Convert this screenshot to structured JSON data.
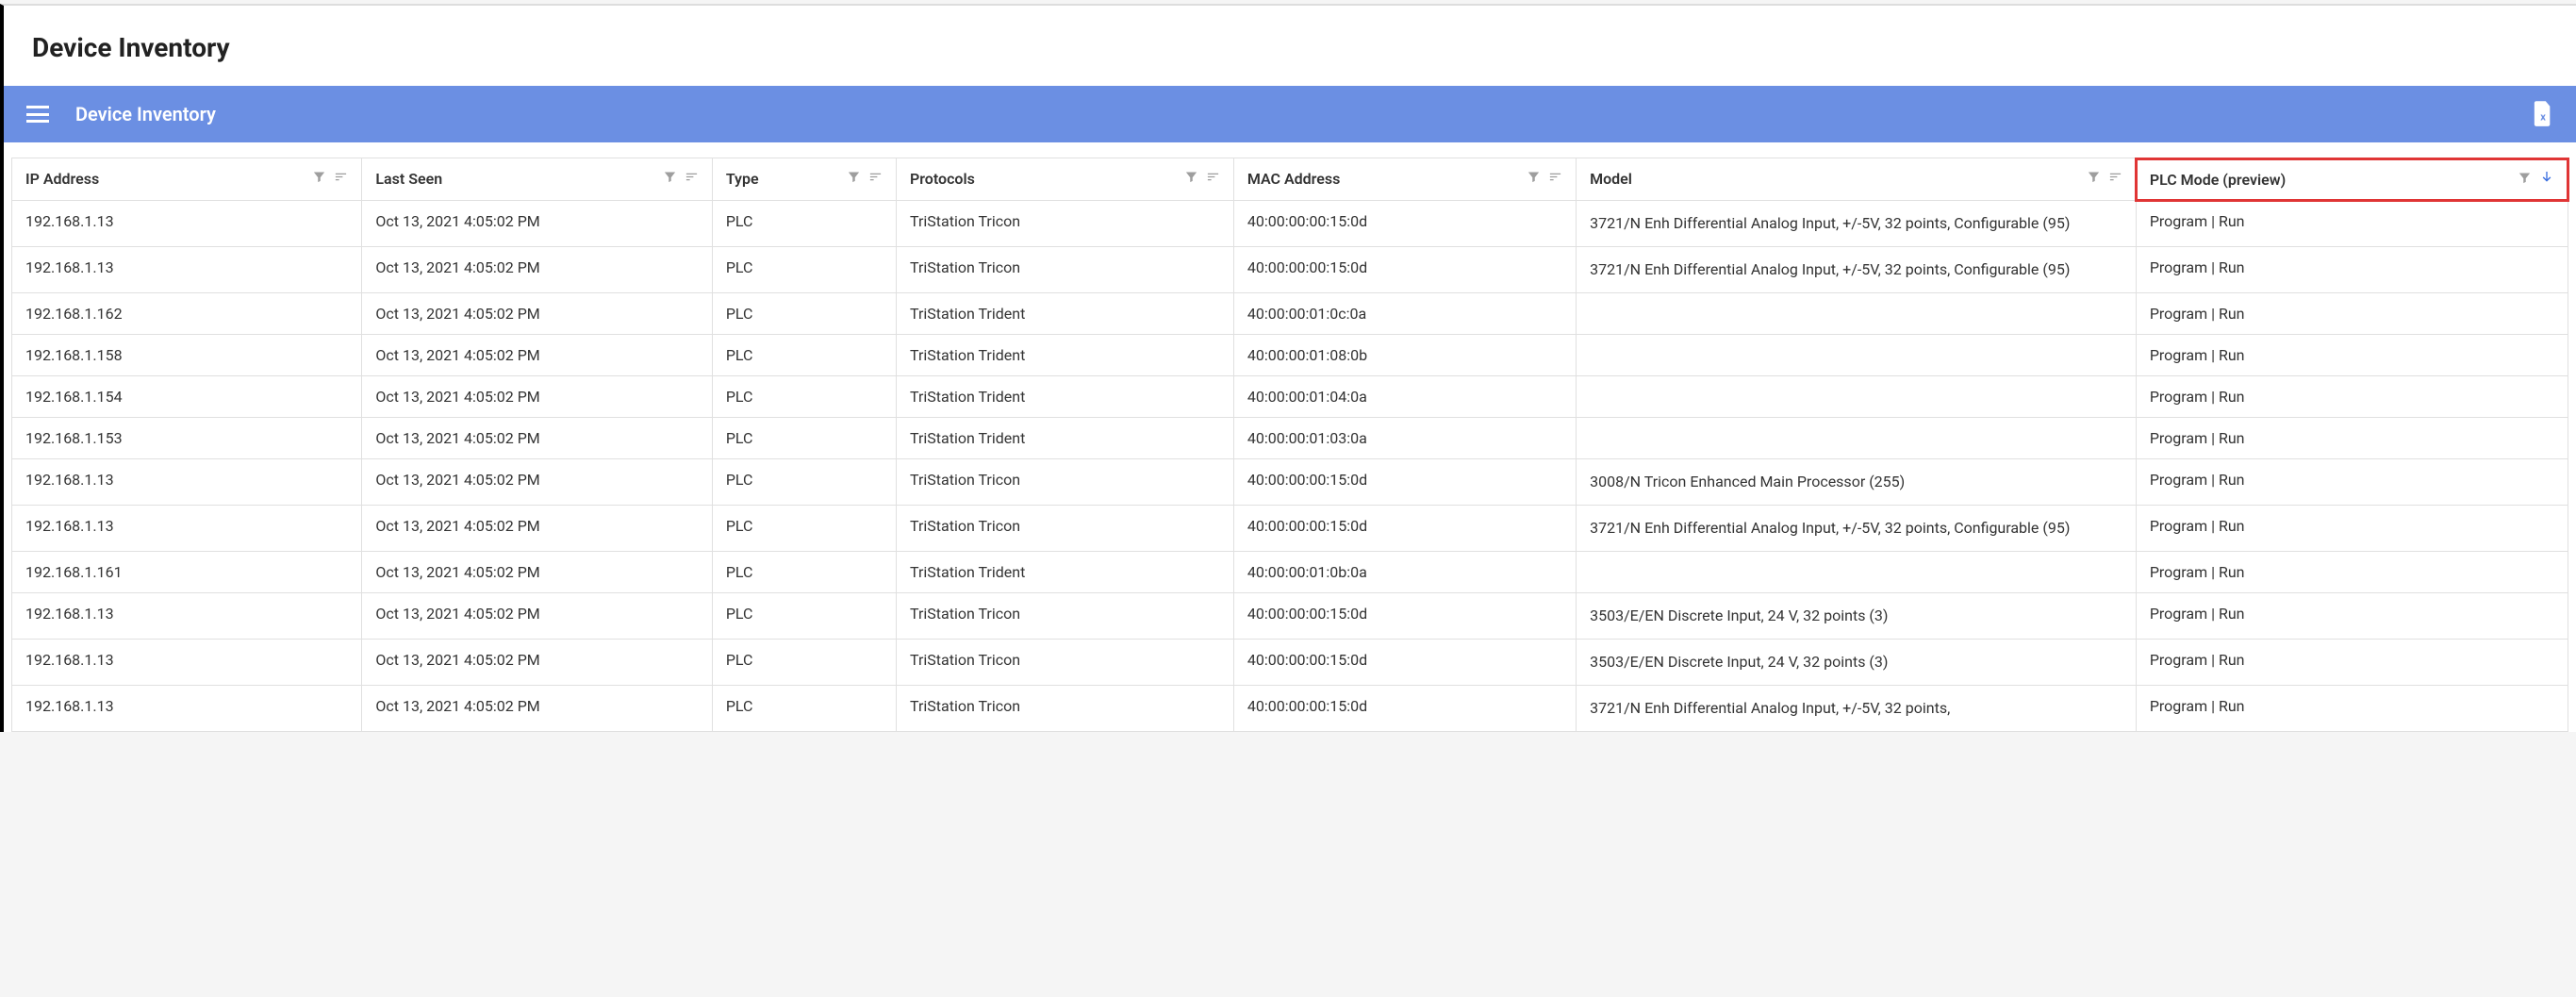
{
  "page": {
    "title": "Device Inventory"
  },
  "header": {
    "title": "Device Inventory"
  },
  "columns": {
    "ip": {
      "label": "IP Address"
    },
    "lastSeen": {
      "label": "Last Seen"
    },
    "type": {
      "label": "Type"
    },
    "proto": {
      "label": "Protocols"
    },
    "mac": {
      "label": "MAC Address"
    },
    "model": {
      "label": "Model"
    },
    "plc": {
      "label": "PLC Mode (preview)"
    }
  },
  "rows": [
    {
      "ip": "192.168.1.13",
      "lastSeen": "Oct 13, 2021 4:05:02 PM",
      "type": "PLC",
      "proto": "TriStation Tricon",
      "mac": "40:00:00:00:15:0d",
      "model": "3721/N Enh Differential Analog Input, +/-5V, 32 points, Configurable (95)",
      "plc": "Program | Run"
    },
    {
      "ip": "192.168.1.13",
      "lastSeen": "Oct 13, 2021 4:05:02 PM",
      "type": "PLC",
      "proto": "TriStation Tricon",
      "mac": "40:00:00:00:15:0d",
      "model": "3721/N Enh Differential Analog Input, +/-5V, 32 points, Configurable (95)",
      "plc": "Program | Run"
    },
    {
      "ip": "192.168.1.162",
      "lastSeen": "Oct 13, 2021 4:05:02 PM",
      "type": "PLC",
      "proto": "TriStation Trident",
      "mac": "40:00:00:01:0c:0a",
      "model": "",
      "plc": "Program | Run"
    },
    {
      "ip": "192.168.1.158",
      "lastSeen": "Oct 13, 2021 4:05:02 PM",
      "type": "PLC",
      "proto": "TriStation Trident",
      "mac": "40:00:00:01:08:0b",
      "model": "",
      "plc": "Program | Run"
    },
    {
      "ip": "192.168.1.154",
      "lastSeen": "Oct 13, 2021 4:05:02 PM",
      "type": "PLC",
      "proto": "TriStation Trident",
      "mac": "40:00:00:01:04:0a",
      "model": "",
      "plc": "Program | Run"
    },
    {
      "ip": "192.168.1.153",
      "lastSeen": "Oct 13, 2021 4:05:02 PM",
      "type": "PLC",
      "proto": "TriStation Trident",
      "mac": "40:00:00:01:03:0a",
      "model": "",
      "plc": "Program | Run"
    },
    {
      "ip": "192.168.1.13",
      "lastSeen": "Oct 13, 2021 4:05:02 PM",
      "type": "PLC",
      "proto": "TriStation Tricon",
      "mac": "40:00:00:00:15:0d",
      "model": "3008/N Tricon Enhanced Main Processor (255)",
      "plc": "Program | Run"
    },
    {
      "ip": "192.168.1.13",
      "lastSeen": "Oct 13, 2021 4:05:02 PM",
      "type": "PLC",
      "proto": "TriStation Tricon",
      "mac": "40:00:00:00:15:0d",
      "model": "3721/N Enh Differential Analog Input, +/-5V, 32 points, Configurable (95)",
      "plc": "Program | Run"
    },
    {
      "ip": "192.168.1.161",
      "lastSeen": "Oct 13, 2021 4:05:02 PM",
      "type": "PLC",
      "proto": "TriStation Trident",
      "mac": "40:00:00:01:0b:0a",
      "model": "",
      "plc": "Program | Run"
    },
    {
      "ip": "192.168.1.13",
      "lastSeen": "Oct 13, 2021 4:05:02 PM",
      "type": "PLC",
      "proto": "TriStation Tricon",
      "mac": "40:00:00:00:15:0d",
      "model": "3503/E/EN Discrete Input, 24 V, 32 points (3)",
      "plc": "Program | Run"
    },
    {
      "ip": "192.168.1.13",
      "lastSeen": "Oct 13, 2021 4:05:02 PM",
      "type": "PLC",
      "proto": "TriStation Tricon",
      "mac": "40:00:00:00:15:0d",
      "model": "3503/E/EN Discrete Input, 24 V, 32 points (3)",
      "plc": "Program | Run"
    },
    {
      "ip": "192.168.1.13",
      "lastSeen": "Oct 13, 2021 4:05:02 PM",
      "type": "PLC",
      "proto": "TriStation Tricon",
      "mac": "40:00:00:00:15:0d",
      "model": "3721/N Enh Differential Analog Input, +/-5V, 32 points,",
      "plc": "Program | Run"
    }
  ]
}
